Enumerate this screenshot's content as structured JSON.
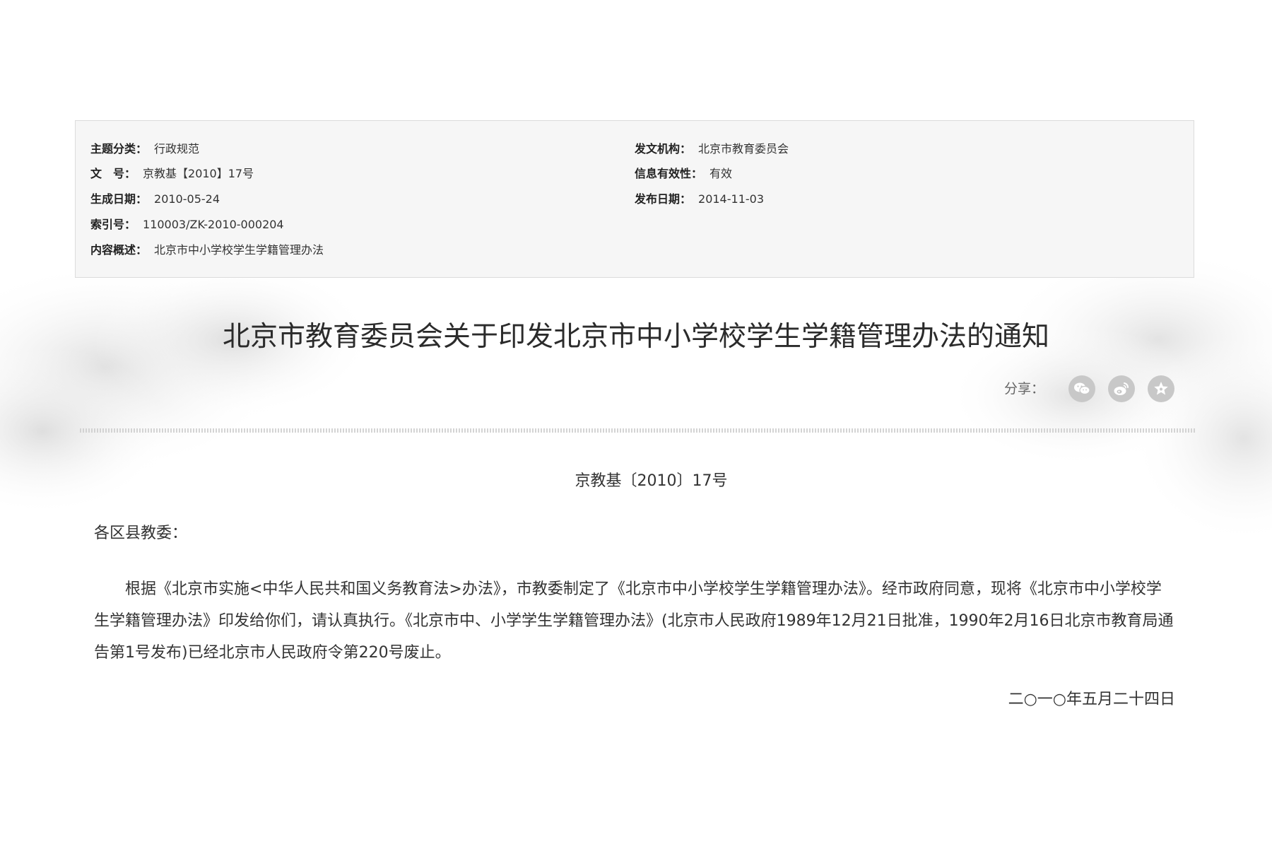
{
  "meta": {
    "category_label": "主题分类：",
    "category_value": "行政规范",
    "doc_no_label": "文　号：",
    "doc_no_value": "京教基【2010】17号",
    "created_label": "生成日期：",
    "created_value": "2010-05-24",
    "index_label": "索引号：",
    "index_value": "110003/ZK-2010-000204",
    "summary_label": "内容概述：",
    "summary_value": "北京市中小学校学生学籍管理办法",
    "issuer_label": "发文机构：",
    "issuer_value": "北京市教育委员会",
    "validity_label": "信息有效性：",
    "validity_value": "有效",
    "published_label": "发布日期：",
    "published_value": "2014-11-03"
  },
  "article": {
    "title": "北京市教育委员会关于印发北京市中小学校学生学籍管理办法的通知",
    "doc_number": "京教基〔2010〕17号",
    "salutation": "各区县教委：",
    "body": "根据《北京市实施<中华人民共和国义务教育法>办法》，市教委制定了《北京市中小学校学生学籍管理办法》。经市政府同意，现将《北京市中小学校学生学籍管理办法》印发给你们，请认真执行。《北京市中、小学学生学籍管理办法》(北京市人民政府1989年12月21日批准，1990年2月16日北京市教育局通告第1号发布)已经北京市人民政府令第220号废止。",
    "date": "二○一○年五月二十四日"
  },
  "share": {
    "label": "分享：",
    "buttons": [
      {
        "icon": "wechat-icon"
      },
      {
        "icon": "weibo-icon"
      },
      {
        "icon": "favorite-star-icon"
      }
    ]
  },
  "colors": {
    "share_icon_bg": "#c8c8c8",
    "meta_bg": "#f6f6f6",
    "text": "#333333"
  }
}
